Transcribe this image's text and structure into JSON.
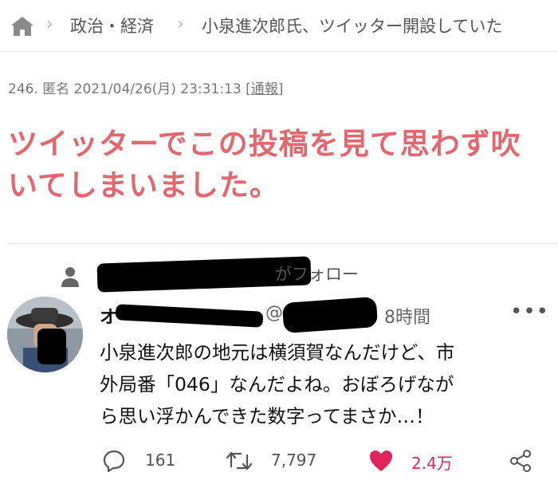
{
  "breadcrumb": {
    "category": "政治・経済",
    "title": "小泉進次郎氏、ツイッター開設していた"
  },
  "comment": {
    "number": "246.",
    "author": "匿名",
    "datetime": "2021/04/26(月) 23:31:13",
    "report_label": "通報",
    "text_line1": "ツイッターでこの投稿を見て思わず吹",
    "text_line2": "いてしまいました。"
  },
  "tweet": {
    "follow_suffix": "がフォロー",
    "name_prefix": "オ",
    "handle_prefix": "@",
    "time": "8時間",
    "more_label": "•••",
    "body_line1": "小泉進次郎の地元は横須賀なんだけど、市",
    "body_line2": "外局番「046」なんだよね。おぼろげなが",
    "body_line3": "ら思い浮かんできた数字ってまさか…！",
    "replies": "161",
    "retweets": "7,797",
    "likes": "2.4万"
  },
  "colors": {
    "accent": "#e2676e",
    "like": "#e0245e"
  },
  "icons": [
    "home-icon",
    "chevron-right-icon",
    "person-icon",
    "reply-icon",
    "retweet-icon",
    "heart-icon",
    "share-icon",
    "more-icon"
  ]
}
